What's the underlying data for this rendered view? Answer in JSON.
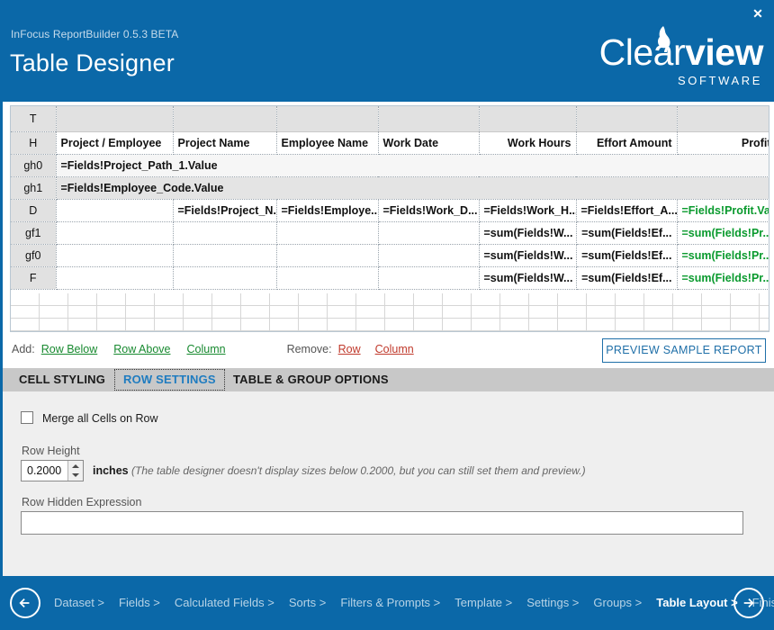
{
  "window": {
    "close_label": "✕",
    "app_version": "InFocus ReportBuilder 0.5.3 BETA",
    "page_title": "Table Designer",
    "brand": {
      "word_thin": "Clear",
      "word_bold": "view",
      "subtitle": "SOFTWARE"
    },
    "accent_color": "#0b68a8"
  },
  "table_designer": {
    "columns": [
      {
        "label": "",
        "align": "left"
      },
      {
        "label": "Project / Employee",
        "align": "left"
      },
      {
        "label": "Project Name",
        "align": "left"
      },
      {
        "label": "Employee Name",
        "align": "left"
      },
      {
        "label": "Work Date",
        "align": "left"
      },
      {
        "label": "Work Hours",
        "align": "right"
      },
      {
        "label": "Effort Amount",
        "align": "right"
      },
      {
        "label": "Profit",
        "align": "right"
      }
    ],
    "rows": [
      {
        "key": "T",
        "label": "T",
        "type": "spacer",
        "cells": [
          "",
          "",
          "",
          "",
          "",
          "",
          ""
        ]
      },
      {
        "key": "H",
        "label": "H",
        "type": "header",
        "cells": [
          {
            "text": "Project / Employee",
            "align": "left",
            "color": "#111111"
          },
          {
            "text": "Project Name",
            "align": "left",
            "color": "#111111"
          },
          {
            "text": "Employee Name",
            "align": "left",
            "color": "#111111"
          },
          {
            "text": "Work Date",
            "align": "left",
            "color": "#111111"
          },
          {
            "text": "Work Hours",
            "align": "right",
            "color": "#111111"
          },
          {
            "text": "Effort Amount",
            "align": "right",
            "color": "#111111"
          },
          {
            "text": "Profit",
            "align": "right",
            "color": "#111111"
          }
        ]
      },
      {
        "key": "gh0",
        "label": "gh0",
        "type": "group-header",
        "merged": true,
        "merged_text": "=Fields!Project_Path_1.Value"
      },
      {
        "key": "gh1",
        "label": "gh1",
        "type": "group-header",
        "merged": true,
        "merged_text": "=Fields!Employee_Code.Value"
      },
      {
        "key": "D",
        "label": "D",
        "type": "detail",
        "cells": [
          {
            "text": "",
            "align": "left",
            "color": "#111111"
          },
          {
            "text": "=Fields!Project_N...",
            "align": "right",
            "color": "#111111"
          },
          {
            "text": "=Fields!Employe...",
            "align": "right",
            "color": "#111111"
          },
          {
            "text": "=Fields!Work_D...",
            "align": "left",
            "color": "#111111"
          },
          {
            "text": "=Fields!Work_H...",
            "align": "right",
            "color": "#111111"
          },
          {
            "text": "=Fields!Effort_A...",
            "align": "right",
            "color": "#111111"
          },
          {
            "text": "=Fields!Profit.Va...",
            "align": "right",
            "color": "#0a9a2e"
          }
        ]
      },
      {
        "key": "gf1",
        "label": "gf1",
        "type": "group-footer",
        "cells": [
          {
            "text": "",
            "align": "left",
            "color": "#111111"
          },
          {
            "text": "",
            "align": "left",
            "color": "#111111"
          },
          {
            "text": "",
            "align": "left",
            "color": "#111111"
          },
          {
            "text": "",
            "align": "left",
            "color": "#111111"
          },
          {
            "text": "=sum(Fields!W...",
            "align": "right",
            "color": "#111111"
          },
          {
            "text": "=sum(Fields!Ef...",
            "align": "right",
            "color": "#111111"
          },
          {
            "text": "=sum(Fields!Pr...",
            "align": "right",
            "color": "#0a9a2e"
          }
        ]
      },
      {
        "key": "gf0",
        "label": "gf0",
        "type": "group-footer",
        "cells": [
          {
            "text": "",
            "align": "left",
            "color": "#111111"
          },
          {
            "text": "",
            "align": "left",
            "color": "#111111"
          },
          {
            "text": "",
            "align": "left",
            "color": "#111111"
          },
          {
            "text": "",
            "align": "left",
            "color": "#111111"
          },
          {
            "text": "=sum(Fields!W...",
            "align": "right",
            "color": "#111111"
          },
          {
            "text": "=sum(Fields!Ef...",
            "align": "right",
            "color": "#111111"
          },
          {
            "text": "=sum(Fields!Pr...",
            "align": "right",
            "color": "#0a9a2e"
          }
        ]
      },
      {
        "key": "F",
        "label": "F",
        "type": "footer",
        "cells": [
          {
            "text": "",
            "align": "left",
            "color": "#111111"
          },
          {
            "text": "",
            "align": "left",
            "color": "#111111"
          },
          {
            "text": "",
            "align": "left",
            "color": "#111111"
          },
          {
            "text": "",
            "align": "left",
            "color": "#111111"
          },
          {
            "text": "=sum(Fields!W...",
            "align": "right",
            "color": "#111111"
          },
          {
            "text": "=sum(Fields!Ef...",
            "align": "right",
            "color": "#111111"
          },
          {
            "text": "=sum(Fields!Pr...",
            "align": "right",
            "color": "#0a9a2e"
          }
        ]
      }
    ]
  },
  "actions": {
    "add_label": "Add:",
    "add_links": [
      "Row Below",
      "Row Above",
      "Column"
    ],
    "remove_label": "Remove:",
    "remove_links": [
      "Row",
      "Column"
    ],
    "preview_button": "PREVIEW SAMPLE REPORT",
    "add_color": "#17892f",
    "remove_color": "#c0392b"
  },
  "tabs": [
    {
      "label": "CELL STYLING",
      "active": false
    },
    {
      "label": "ROW SETTINGS",
      "active": true
    },
    {
      "label": "TABLE & GROUP OPTIONS",
      "active": false
    }
  ],
  "row_settings": {
    "merge_checkbox_label": "Merge all Cells on Row",
    "merge_checked": false,
    "row_height_label": "Row Height",
    "row_height_value": "0.2000",
    "row_height_units": "inches",
    "row_height_hint": "(The table designer doesn't display sizes below 0.2000, but you can still set them and preview.)",
    "hidden_expression_label": "Row Hidden Expression",
    "hidden_expression_value": "",
    "hidden_expression_placeholder": ""
  },
  "footer_nav": {
    "steps": [
      {
        "label": "Dataset >",
        "current": false
      },
      {
        "label": "Fields >",
        "current": false
      },
      {
        "label": "Calculated Fields >",
        "current": false
      },
      {
        "label": "Sorts >",
        "current": false
      },
      {
        "label": "Filters & Prompts >",
        "current": false
      },
      {
        "label": "Template >",
        "current": false
      },
      {
        "label": "Settings >",
        "current": false
      },
      {
        "label": "Groups >",
        "current": false
      },
      {
        "label": "Table Layout >",
        "current": true
      },
      {
        "label": "Finish",
        "current": false
      }
    ]
  }
}
